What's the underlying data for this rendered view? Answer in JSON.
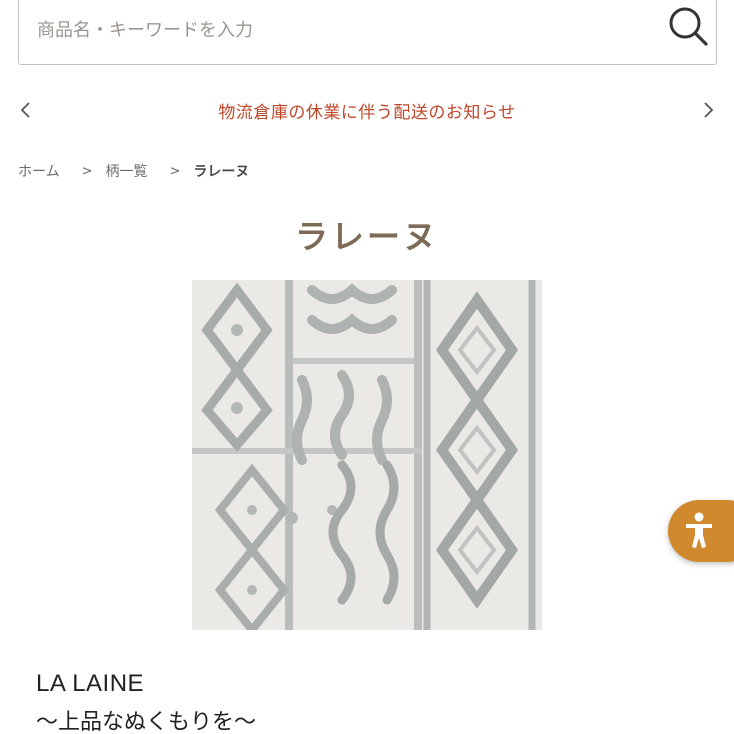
{
  "search": {
    "placeholder": "商品名・キーワードを入力",
    "value": "",
    "icon": "search-icon"
  },
  "announcement": {
    "text": "物流倉庫の休業に伴う配送のお知らせ",
    "color": "#c0472a",
    "prev_icon": "chevron-left-icon",
    "next_icon": "chevron-right-icon"
  },
  "breadcrumb": {
    "items": [
      {
        "label": "ホーム"
      },
      {
        "label": "柄一覧"
      },
      {
        "label": "ラレーヌ"
      }
    ],
    "separator": ">"
  },
  "product": {
    "title": "ラレーヌ",
    "title_color": "#7d6a57",
    "brand_name": "LA LAINE",
    "tagline": "〜上品なぬくもりを〜"
  },
  "accessibility": {
    "icon": "accessibility-person-icon",
    "color": "#d08a2d"
  }
}
